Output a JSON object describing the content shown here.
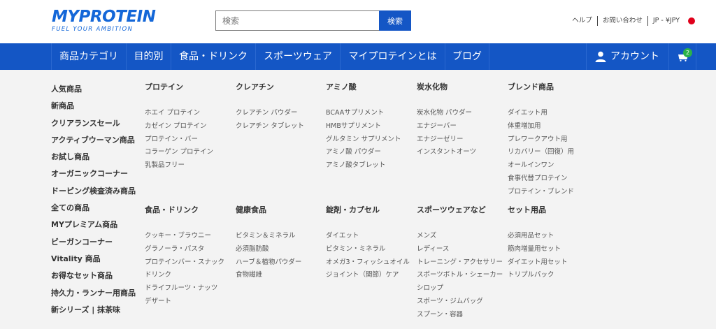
{
  "header": {
    "logo_main": "MYPROTEIN",
    "logo_sub": "FUEL YOUR AMBITION",
    "search_placeholder": "検索",
    "search_button": "検索",
    "util_links": [
      "ヘルプ",
      "お問い合わせ",
      "JP - ¥JPY"
    ],
    "brand_color": "#1456c5",
    "flag_color": "#e0001b"
  },
  "nav": {
    "items": [
      "商品カテゴリ",
      "目的別",
      "食品・ドリンク",
      "スポーツウェア",
      "マイプロテインとは",
      "ブログ"
    ],
    "account_label": "アカウント",
    "cart_count": "2",
    "icons": [
      "user-icon",
      "basket-icon"
    ]
  },
  "menu": {
    "left": [
      "人気商品",
      "新商品",
      "クリアランスセール",
      "アクティブウーマン商品",
      "お試し商品",
      "オーガニックコーナー",
      "ドーピング検査済み商品",
      "全ての商品",
      "MYプレミアム商品",
      "ビーガンコーナー",
      "Vitality 商品",
      "お得なセット商品",
      "持久力・ランナー用商品",
      "新シリーズ | 抹茶味"
    ],
    "row1": [
      {
        "heading": "プロテイン",
        "items": [
          "ホエイ プロテイン",
          "カゼイン プロテイン",
          "プロテイン・バー",
          "コラーゲン プロテイン",
          "乳製品フリー"
        ]
      },
      {
        "heading": "クレアチン",
        "items": [
          "クレアチン パウダー",
          "クレアチン タブレット"
        ]
      },
      {
        "heading": "アミノ酸",
        "items": [
          "BCAAサプリメント",
          "HMBサプリメント",
          "グルタミン サプリメント",
          "アミノ酸 パウダー",
          "アミノ酸タブレット"
        ]
      },
      {
        "heading": "炭水化物",
        "items": [
          "炭水化物 パウダー",
          "エナジーバー",
          "エナジーゼリー",
          "インスタントオーツ"
        ]
      },
      {
        "heading": "ブレンド商品",
        "items": [
          "ダイエット用",
          "体重増加用",
          "プレワークアウト用",
          "リカバリー（回復）用",
          "オールインワン",
          "食事代替プロテイン",
          "プロテイン・ブレンド"
        ]
      }
    ],
    "row2": [
      {
        "heading": "食品・ドリンク",
        "items": [
          "クッキー・ブラウニー",
          "グラノーラ・パスタ",
          "プロテインバー・スナック",
          "ドリンク",
          "ドライフルーツ・ナッツ",
          "デザート"
        ]
      },
      {
        "heading": "健康食品",
        "items": [
          "ビタミン＆ミネラル",
          "必須脂肪酸",
          "ハーブ＆植物パウダー",
          "食物繊維"
        ]
      },
      {
        "heading": "錠剤・カプセル",
        "items": [
          "ダイエット",
          "ビタミン・ミネラル",
          "オメガ3・フィッシュオイル",
          "ジョイント（関節）ケア"
        ]
      },
      {
        "heading": "スポーツウェアなど",
        "items": [
          "メンズ",
          "レディース",
          "トレーニング・アクセサリー",
          "スポーツボトル・シェーカー",
          "シロップ",
          "スポーツ・ジムバッグ",
          "スプーン・容器"
        ]
      },
      {
        "heading": "セット用品",
        "items": [
          "必須用品セット",
          "筋肉増量用セット",
          "ダイエット用セット",
          "トリプルパック"
        ]
      }
    ]
  }
}
